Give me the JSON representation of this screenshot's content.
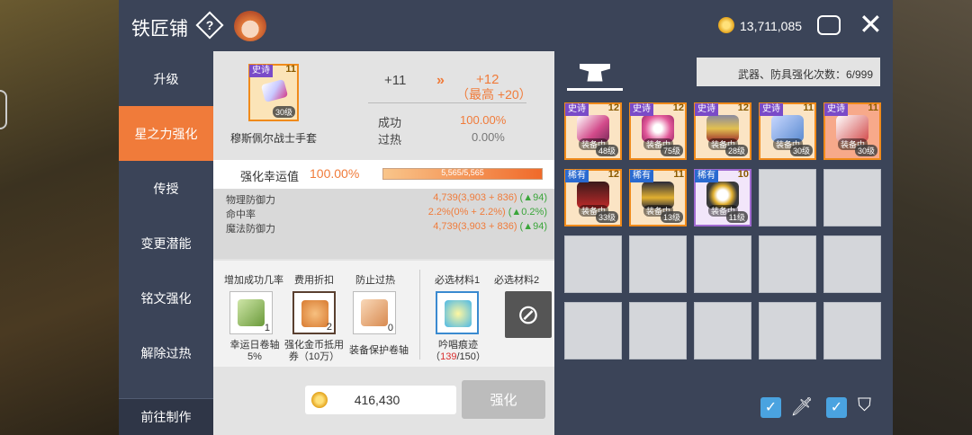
{
  "header": {
    "title": "铁匠铺",
    "help": "?",
    "gold": "13,711,085"
  },
  "sidebar": {
    "items": [
      "升级",
      "星之力强化",
      "传授",
      "变更潜能",
      "铭文强化",
      "解除过热"
    ],
    "bottom": "前往制作"
  },
  "target": {
    "tag": "史诗",
    "star": "11",
    "level": "30级",
    "name": "穆斯佩尔战士手套"
  },
  "enhance": {
    "from": "+11",
    "arrow": "»",
    "to": "+12",
    "max": "（最高 +20）"
  },
  "stats": {
    "success_label": "成功",
    "success_value": "100.00%",
    "overheat_label": "过热",
    "overheat_value": "0.00%"
  },
  "luck": {
    "label": "强化幸运值",
    "value": "100.00%",
    "bar_text": "5,565/5,565",
    "fill": 1.0
  },
  "attributes": [
    {
      "name": "物理防御力",
      "value": "4,739(3,903 + 836) ",
      "delta": "(▲94)"
    },
    {
      "name": "命中率",
      "value": "2.2%(0% + 2.2%) ",
      "delta": "(▲0.2%)"
    },
    {
      "name": "魔法防御力",
      "value": "4,739(3,903 + 836) ",
      "delta": "(▲94)"
    }
  ],
  "materials": {
    "headers": [
      "增加成功几率",
      "费用折扣",
      "防止过热",
      "必选材料1",
      "必选材料2"
    ],
    "items": [
      {
        "count": "1",
        "caption1": "幸运日卷轴",
        "caption2": "5%"
      },
      {
        "count": "2",
        "caption1": "强化金币抵用",
        "caption2": "券（10万）"
      },
      {
        "count": "0",
        "caption1": "装备保护卷轴",
        "caption2": ""
      },
      {
        "caption1": "吟唱痕迹",
        "owned": "139",
        "required": "/150",
        "open": "（",
        "close": "）"
      }
    ],
    "forbid": "⊘"
  },
  "cost": {
    "gold": "416,430",
    "button": "强化"
  },
  "right": {
    "count_text": "武器、防具强化次数：6/999",
    "inventory": [
      {
        "tag": "史诗",
        "star": "12",
        "equipped": "装备中",
        "level": "48级"
      },
      {
        "tag": "史诗",
        "star": "12",
        "equipped": "装备中",
        "level": "75级"
      },
      {
        "tag": "史诗",
        "star": "12",
        "equipped": "装备中",
        "level": "28级"
      },
      {
        "tag": "史诗",
        "star": "11",
        "equipped": "装备中",
        "level": "30级"
      },
      {
        "tag": "史诗",
        "star": "11",
        "equipped": "装备中",
        "level": "30级"
      },
      {
        "tag": "稀有",
        "star": "12",
        "equipped": "装备中",
        "level": "33级"
      },
      {
        "tag": "稀有",
        "star": "11",
        "equipped": "装备中",
        "level": "13级"
      },
      {
        "tag": "稀有",
        "star": "10",
        "equipped": "装备中",
        "level": "11级"
      }
    ]
  },
  "filters": {
    "check": "✓",
    "sword": "🗡",
    "shield": "⛉"
  }
}
